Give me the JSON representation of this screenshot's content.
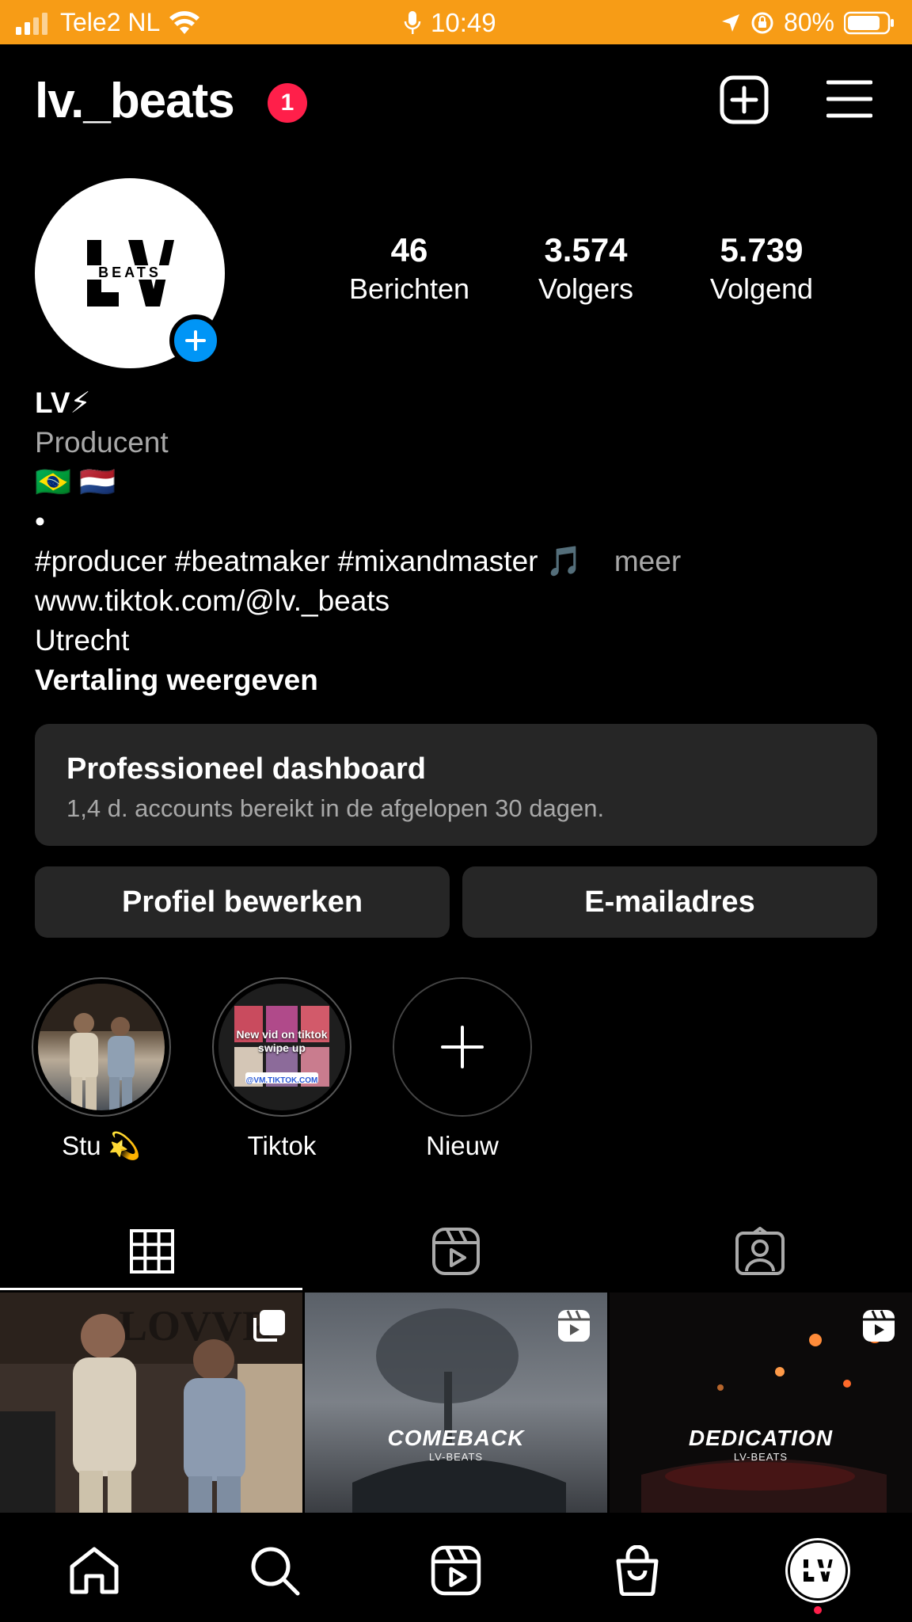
{
  "status_bar": {
    "carrier": "Tele2 NL",
    "time": "10:49",
    "battery": "80%",
    "bg_color": "#F79C16"
  },
  "header": {
    "username": "lv._beats",
    "notification_count": "1",
    "icons": [
      "add-post-icon",
      "menu-icon"
    ]
  },
  "profile": {
    "avatar_logo_text": "LV",
    "avatar_logo_sub": "BEATS",
    "stats": [
      {
        "value": "46",
        "label": "Berichten"
      },
      {
        "value": "3.574",
        "label": "Volgers"
      },
      {
        "value": "5.739",
        "label": "Volgend"
      }
    ],
    "name": "LV⚡",
    "category": "Producent",
    "flags": "🇧🇷 🇳🇱",
    "dot": "•",
    "bio_line": "#producer #beatmaker #mixandmaster 🎵",
    "more": "meer",
    "link": "www.tiktok.com/@lv._beats",
    "location": "Utrecht",
    "translate": "Vertaling weergeven"
  },
  "dashboard": {
    "title": "Professioneel dashboard",
    "subtitle": "1,4 d. accounts bereikt in de afgelopen 30 dagen."
  },
  "buttons": {
    "edit_profile": "Profiel bewerken",
    "email": "E-mailadres"
  },
  "highlights": [
    {
      "label": "Stu 💫"
    },
    {
      "label": "Tiktok",
      "overlay_text": "New vid on tiktok swipe up",
      "overlay_url": "@VM.TIKTOK.COM"
    },
    {
      "label": "Nieuw"
    }
  ],
  "tabs": [
    "grid-icon",
    "reels-icon",
    "tagged-icon"
  ],
  "grid": [
    {
      "type": "photo",
      "overlay": "LOVVR"
    },
    {
      "type": "reel",
      "title": "COMEBACK",
      "subtitle": "LV-BEATS"
    },
    {
      "type": "reel",
      "title": "DEDICATION",
      "subtitle": "LV-BEATS"
    }
  ],
  "bottom_nav": [
    "home-icon",
    "search-icon",
    "reels-icon",
    "shop-icon",
    "profile-avatar"
  ],
  "colors": {
    "accent_blue": "#0095F6",
    "badge_red": "#FF1F4A",
    "card_bg": "#262626",
    "muted_text": "#A8A8A8"
  }
}
